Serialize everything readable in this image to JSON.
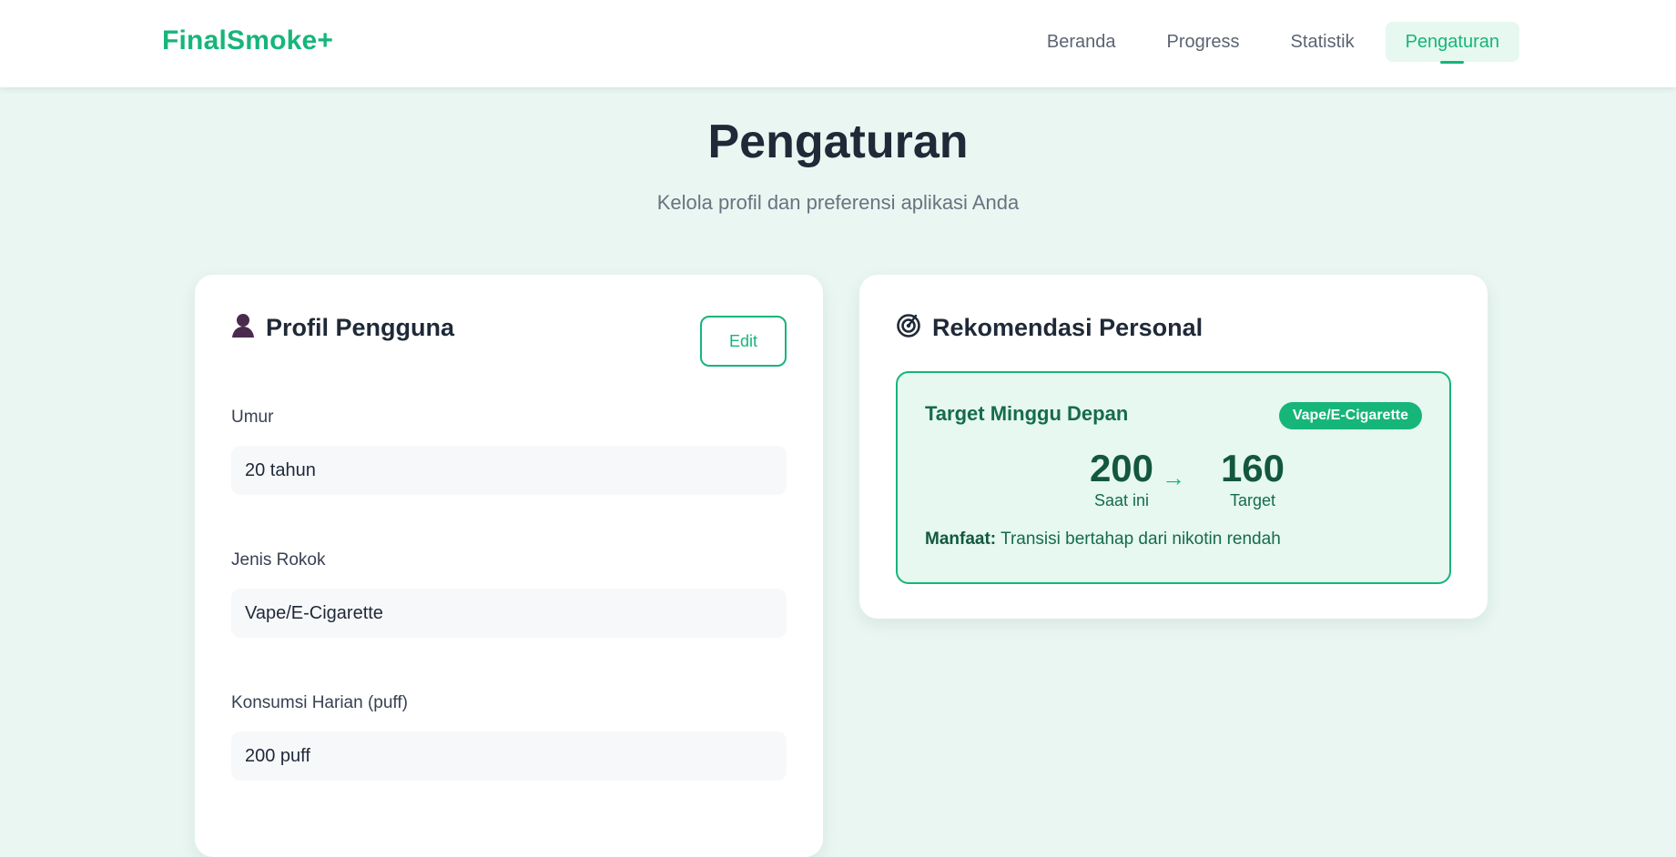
{
  "app": {
    "brand": "FinalSmoke+"
  },
  "nav": {
    "items": [
      {
        "label": "Beranda"
      },
      {
        "label": "Progress"
      },
      {
        "label": "Statistik"
      },
      {
        "label": "Pengaturan",
        "active": true
      }
    ]
  },
  "page": {
    "title": "Pengaturan",
    "subtitle": "Kelola profil dan preferensi aplikasi Anda"
  },
  "profile": {
    "icon": "user-icon",
    "title": "Profil Pengguna",
    "edit_label": "Edit",
    "fields": [
      {
        "label": "Umur",
        "value": "20 tahun"
      },
      {
        "label": "Jenis Rokok",
        "value": "Vape/E-Cigarette"
      },
      {
        "label": "Konsumsi Harian (puff)",
        "value": "200 puff"
      }
    ]
  },
  "recommendation": {
    "icon": "target-icon",
    "title": "Rekomendasi Personal",
    "box_title": "Target Minggu Depan",
    "badge": "Vape/E-Cigarette",
    "current": {
      "value": "200",
      "label": "Saat ini"
    },
    "arrow": "→",
    "target": {
      "value": "160",
      "label": "Target"
    },
    "benefit_label": "Manfaat:",
    "benefit_text": "Transisi bertahap dari nikotin rendah"
  },
  "colors": {
    "accent": "#16b57a",
    "background": "#e9f6f2",
    "dark_green": "#13573f"
  }
}
